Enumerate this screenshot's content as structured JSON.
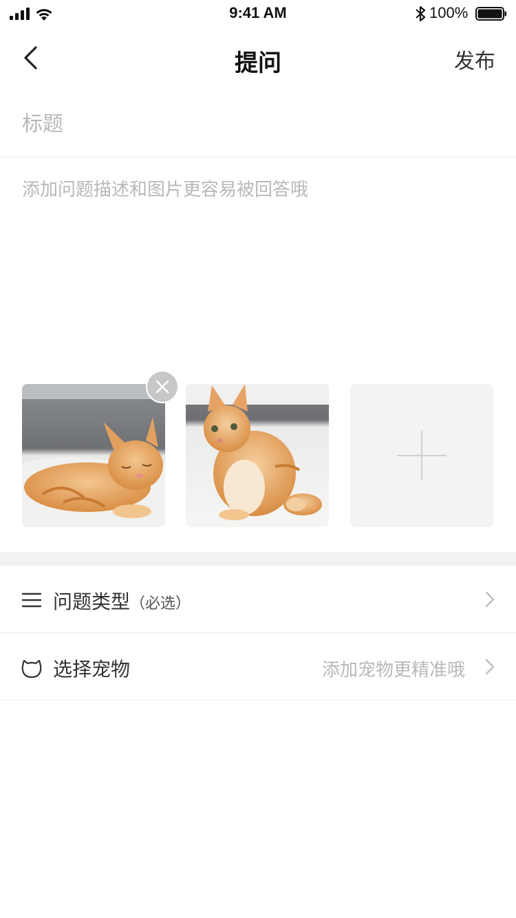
{
  "status_bar": {
    "time": "9:41 AM",
    "battery_percent": "100%",
    "battery_level": 1.0,
    "icons": [
      "signal-icon",
      "wifi-icon",
      "bluetooth-icon",
      "battery-icon"
    ]
  },
  "nav": {
    "back_icon": "back-arrow-icon",
    "title": "提问",
    "publish_label": "发布"
  },
  "form": {
    "title_placeholder": "标题",
    "description_placeholder": "添加问题描述和图片更容易被回答哦"
  },
  "photos": {
    "items": [
      {
        "name": "cat-photo-1"
      },
      {
        "name": "cat-photo-2"
      }
    ],
    "remove_icon": "close-icon",
    "add_icon": "plus-icon"
  },
  "options": {
    "question_type": {
      "icon": "menu-lines-icon",
      "label": "问题类型",
      "sub_label": "（必选）"
    },
    "select_pet": {
      "icon": "cat-head-icon",
      "label": "选择宠物",
      "hint": "添加宠物更精准哦"
    }
  },
  "colors": {
    "text_primary": "#333333",
    "placeholder": "#b8b8b8",
    "divider": "#ebebeb",
    "section_band": "#f2f2f2",
    "add_tile": "#f3f3f3"
  }
}
